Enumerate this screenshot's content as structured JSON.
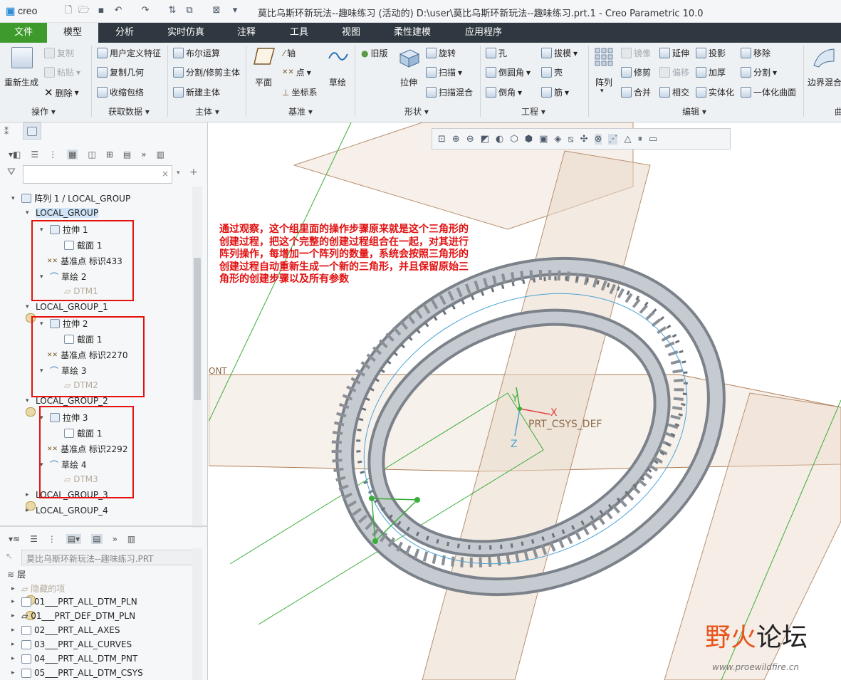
{
  "app": {
    "logo": "creo",
    "window_title": "莫比乌斯环新玩法--趣味练习 (活动的) D:\\user\\莫比乌斯环新玩法--趣味练习.prt.1 - Creo Parametric 10.0"
  },
  "tabs": [
    "文件",
    "模型",
    "分析",
    "实时仿真",
    "注释",
    "工具",
    "视图",
    "柔性建模",
    "应用程序"
  ],
  "ribbon": {
    "operations": {
      "regen": "重新生成",
      "copy": "复制",
      "paste": "粘贴",
      "delete": "删除",
      "group": "操作"
    },
    "get_data": {
      "udf": "用户定义特征",
      "copy_geom": "复制几何",
      "shrinkwrap": "收缩包络",
      "group": "获取数据"
    },
    "body": {
      "boolean": "布尔运算",
      "split": "分割/修剪主体",
      "new_body": "新建主体",
      "group": "主体"
    },
    "datum": {
      "plane": "平面",
      "axis": "轴",
      "point": "点",
      "csys": "坐标系",
      "sketch": "草绘",
      "group": "基准"
    },
    "shapes": {
      "legacy": "旧版",
      "extrude": "拉伸",
      "revolve": "旋转",
      "sweep": "扫描",
      "swept_blend": "扫描混合",
      "group": "形状"
    },
    "engineering": {
      "hole": "孔",
      "round": "倒圆角",
      "chamfer": "倒角",
      "draft": "拔模",
      "shell": "壳",
      "rib": "筋",
      "group": "工程"
    },
    "editing": {
      "pattern": "阵列",
      "mirror": "镜像",
      "trim": "修剪",
      "merge": "合并",
      "extend": "延伸",
      "offset": "偏移",
      "intersect": "相交",
      "project": "投影",
      "thicken": "加厚",
      "solidify": "实体化",
      "move": "移除",
      "split": "分割",
      "unify": "一体化曲面",
      "group": "编辑"
    },
    "surfaces": {
      "boundary": "边界混合",
      "group": "曲"
    }
  },
  "model_tree": {
    "search_placeholder": "",
    "items": [
      {
        "label": "阵列 1 / LOCAL_GROUP"
      },
      {
        "label": "LOCAL_GROUP"
      },
      {
        "label": "拉伸 1"
      },
      {
        "label": "截面 1"
      },
      {
        "label": "基准点 标识433"
      },
      {
        "label": "草绘 2"
      },
      {
        "label": "DTM1"
      },
      {
        "label": "LOCAL_GROUP_1"
      },
      {
        "label": "拉伸 2"
      },
      {
        "label": "截面 1"
      },
      {
        "label": "基准点 标识2270"
      },
      {
        "label": "草绘 3"
      },
      {
        "label": "DTM2"
      },
      {
        "label": "LOCAL_GROUP_2"
      },
      {
        "label": "拉伸 3"
      },
      {
        "label": "截面 1"
      },
      {
        "label": "基准点 标识2292"
      },
      {
        "label": "草绘 4"
      },
      {
        "label": "DTM3"
      },
      {
        "label": "LOCAL_GROUP_3"
      },
      {
        "label": "LOCAL_GROUP_4"
      }
    ]
  },
  "layer_tree": {
    "model_name": "莫比乌斯环新玩法--趣味练习.PRT",
    "header": "层",
    "items": [
      "隐藏的项",
      "01___PRT_ALL_DTM_PLN",
      "01___PRT_DEF_DTM_PLN",
      "02___PRT_ALL_AXES",
      "03___PRT_ALL_CURVES",
      "04___PRT_ALL_DTM_PNT",
      "05___PRT_ALL_DTM_CSYS"
    ]
  },
  "viewport": {
    "annotation": "通过观察，这个组里面的操作步骤原来就是这个三角形的创建过程，把这个完整的创建过程组合在一起，对其进行阵列操作，每增加一个阵列的数量，系统会按照三角形的创建过程自动重新生成一个新的三角形，并且保留原始三角形的创建步骤以及所有参数",
    "csys_label": "PRT_CSYS_DEF",
    "axis_x": "X",
    "axis_y": "Y",
    "axis_z": "Z",
    "plane_label": "ONT",
    "watermark": {
      "brand_a": "野火",
      "brand_b": "论坛",
      "url": "www.proewildfire.cn"
    }
  },
  "colors": {
    "accent": "#3f9a2c",
    "tabbar": "#2f3840",
    "annotation": "#e11010",
    "selection": "#cfe4f7"
  }
}
